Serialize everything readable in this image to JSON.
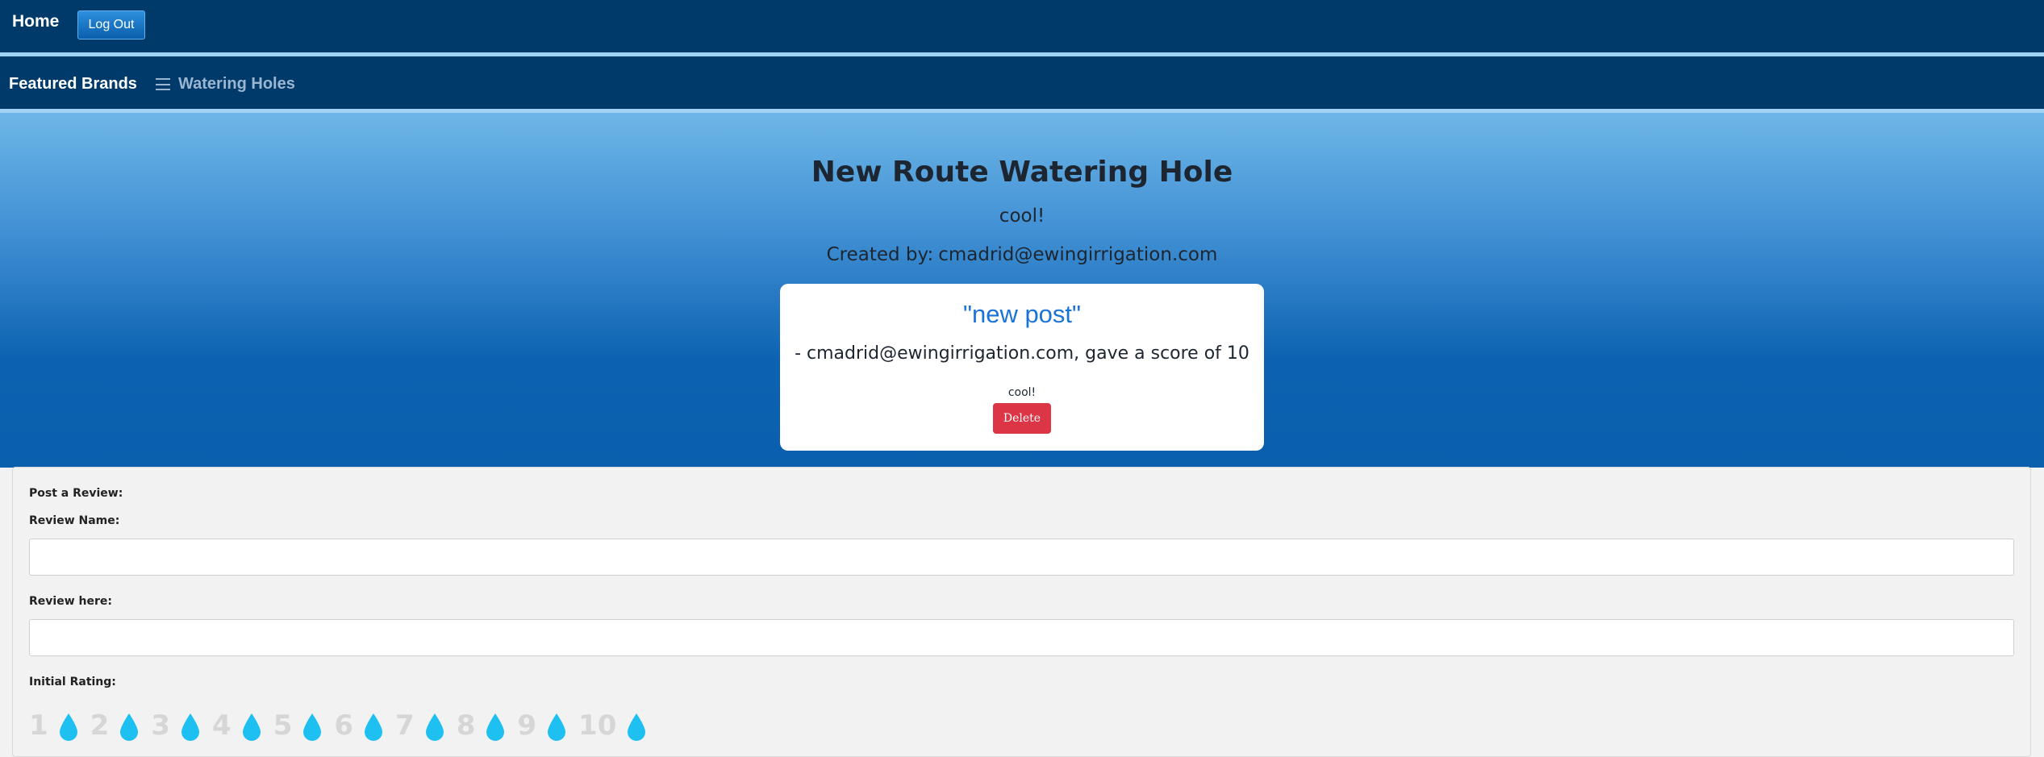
{
  "topbar": {
    "home_label": "Home",
    "logout_label": "Log Out"
  },
  "subnav": {
    "featured_label": "Featured Brands",
    "watering_label": "Watering Holes"
  },
  "hero": {
    "title": "New Route Watering Hole",
    "description": "cool!",
    "created_by_label": "Created by:",
    "created_by_value": "cmadrid@ewingirrigation.com"
  },
  "review": {
    "title": "\"new post\"",
    "author_line": "- cmadrid@ewingirrigation.com, gave a score of 10",
    "body": "cool!",
    "delete_label": "Delete"
  },
  "form": {
    "post_label": "Post a Review:",
    "name_label": "Review Name:",
    "name_value": "",
    "review_label": "Review here:",
    "review_value": "",
    "rating_label": "Initial Rating:",
    "rating_options": [
      "1",
      "2",
      "3",
      "4",
      "5",
      "6",
      "7",
      "8",
      "9",
      "10"
    ],
    "rating_icon": "water-drop-icon"
  },
  "colors": {
    "nav_bg": "#003a6b",
    "nav_border": "#9fd2f3",
    "link_blue": "#1a73d9",
    "delete_red": "#dc3545",
    "drop_blue": "#1ec0f2"
  }
}
